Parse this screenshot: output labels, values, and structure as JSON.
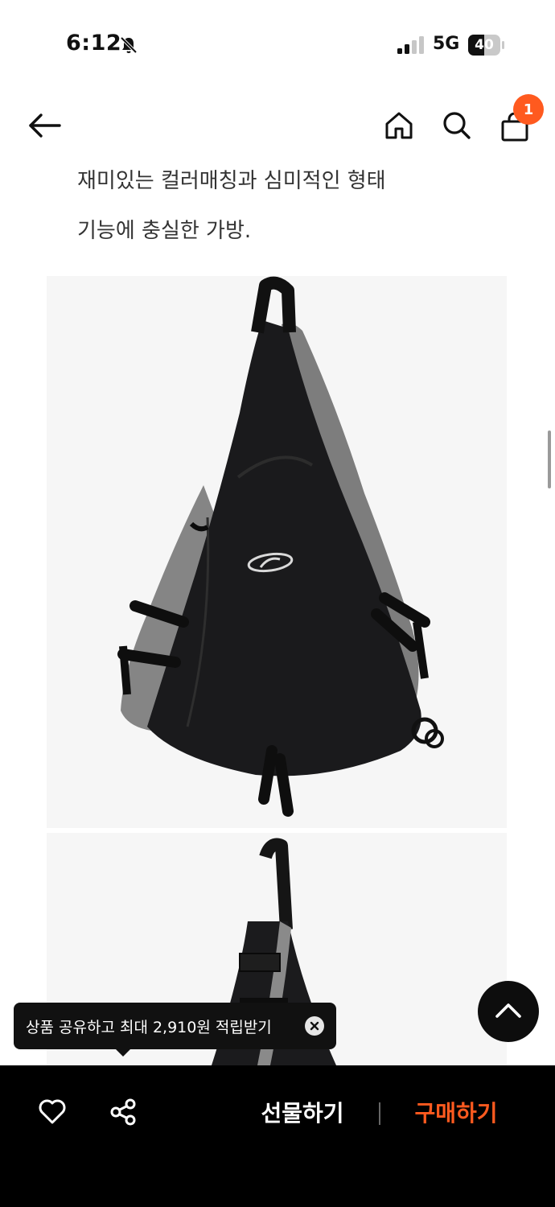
{
  "status_bar": {
    "time": "6:12",
    "network": "5G",
    "battery": "40"
  },
  "nav": {
    "cart_count": "1"
  },
  "description": {
    "line1": "재미있는 컬러매칭과 심미적인 형태",
    "line2": "기능에 충실한 가방."
  },
  "toast": {
    "text": "상품 공유하고 최대 2,910원 적립받기"
  },
  "bottom_bar": {
    "gift_label": "선물하기",
    "buy_label": "구매하기"
  },
  "colors": {
    "accent": "#ff5a1f",
    "bar_background": "#000000"
  }
}
